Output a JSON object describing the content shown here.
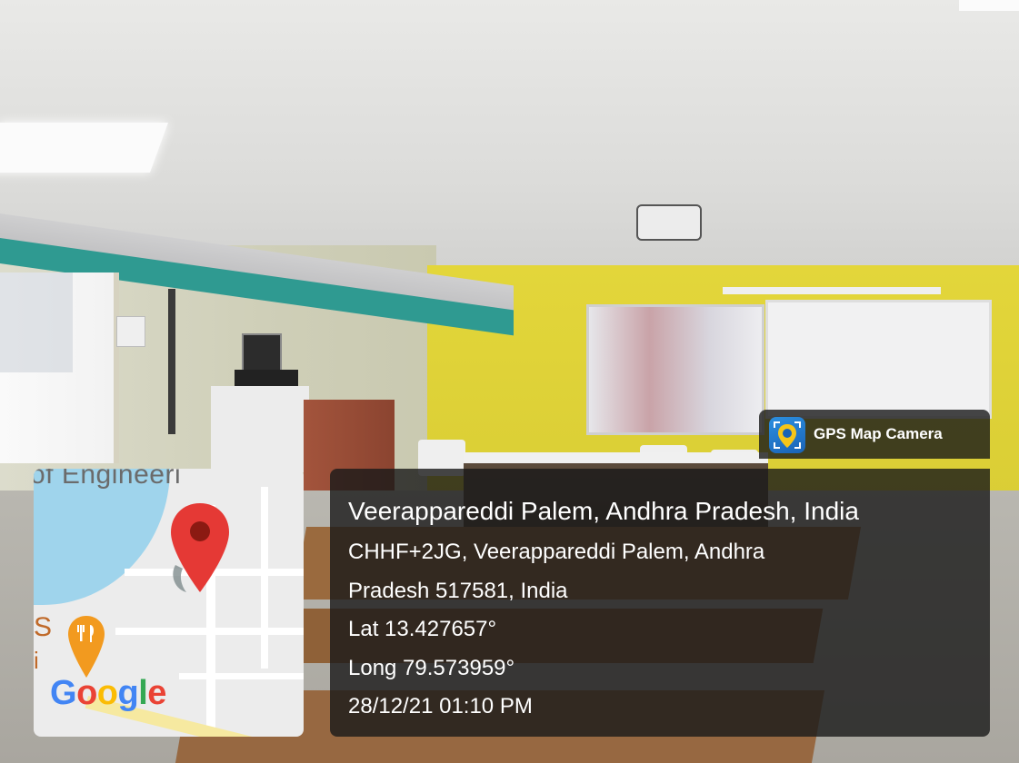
{
  "stamp": {
    "app_name": "GPS Map Camera",
    "place_title": "Veerappareddi Palem, Andhra Pradesh, India",
    "address_line1": "CHHF+2JG, Veerappareddi Palem, Andhra",
    "address_line2": "Pradesh 517581, India",
    "latitude": "Lat 13.427657°",
    "longitude": "Long 79.573959°",
    "datetime": "28/12/21 01:10 PM"
  },
  "map": {
    "top_label": "of Engineeri",
    "google_logo": "Google",
    "pin_icon": "map-pin-icon",
    "restaurant_icon": "restaurant-icon",
    "colors": {
      "pin": "#e53935",
      "water": "#9fd4ec",
      "restaurant": "#f29a1f"
    }
  },
  "colors": {
    "overlay": "#191919",
    "text": "#ffffff",
    "app_icon": "#1a63b6"
  }
}
